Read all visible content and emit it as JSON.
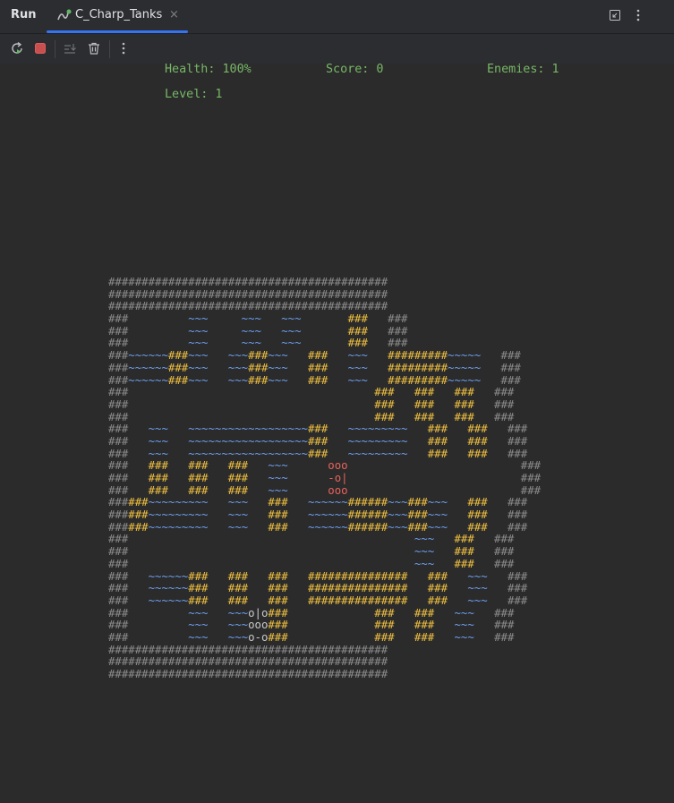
{
  "header": {
    "run_label": "Run",
    "tab_title": "C_Charp_Tanks",
    "tab_close": "×",
    "icons": [
      "restore-layout-icon",
      "more-options-icon"
    ]
  },
  "toolbar": {
    "icons": [
      "rerun-icon",
      "stop-icon",
      "scroll-to-end-icon",
      "clear-all-icon",
      "more-vertical-icon"
    ]
  },
  "status": {
    "health": "Health: 100%",
    "score": "Score: 0",
    "enemies": "Enemies: 1",
    "level": "Level: 1"
  },
  "colors": {
    "wall": "#8c8c8c",
    "brick": "#f0c040",
    "water": "#6ea0f0",
    "enemy": "#e8625c",
    "player": "#c8c8c8",
    "status_text": "#77b767",
    "accent": "#3574f0"
  },
  "map": [
    "##########################################",
    "##########################################",
    "##########################################",
    "###         ~~~     ~~~   ~~~       ###   ###",
    "###         ~~~     ~~~   ~~~       ###   ###",
    "###         ~~~     ~~~   ~~~       ###   ###",
    "###~~~~~~###~~~   ~~~###~~~   ###   ~~~   #########~~~~~   ###",
    "###~~~~~~###~~~   ~~~###~~~   ###   ~~~   #########~~~~~   ###",
    "###~~~~~~###~~~   ~~~###~~~   ###   ~~~   #########~~~~~   ###",
    "###                                     ###   ###   ###   ###",
    "###                                     ###   ###   ###   ###",
    "###                                     ###   ###   ###   ###",
    "###   ~~~   ~~~~~~~~~~~~~~~~~~###   ~~~~~~~~~   ###   ###   ###",
    "###   ~~~   ~~~~~~~~~~~~~~~~~~###   ~~~~~~~~~   ###   ###   ###",
    "###   ~~~   ~~~~~~~~~~~~~~~~~~###   ~~~~~~~~~   ###   ###   ###",
    "###   ###   ###   ###   ~~~      ooo                          ###",
    "###   ###   ###   ###   ~~~      -o|                          ###",
    "###   ###   ###   ###   ~~~      ooo                          ###",
    "######~~~~~~~~~   ~~~   ###   ~~~~~~######~~~###~~~   ###   ###",
    "######~~~~~~~~~   ~~~   ###   ~~~~~~######~~~###~~~   ###   ###",
    "######~~~~~~~~~   ~~~   ###   ~~~~~~######~~~###~~~   ###   ###",
    "###                                           ~~~   ###   ###",
    "###                                           ~~~   ###   ###",
    "###                                           ~~~   ###   ###",
    "###   ~~~~~~###   ###   ###   ###############   ###   ~~~   ###",
    "###   ~~~~~~###   ###   ###   ###############   ###   ~~~   ###",
    "###   ~~~~~~###   ###   ###   ###############   ###   ~~~   ###",
    "###         ~~~   ~~~o|o###             ###   ###   ~~~   ###",
    "###         ~~~   ~~~ooo###             ###   ###   ~~~   ###",
    "###         ~~~   ~~~o-o###             ###   ###   ~~~   ###",
    "##########################################",
    "##########################################",
    "##########################################"
  ]
}
